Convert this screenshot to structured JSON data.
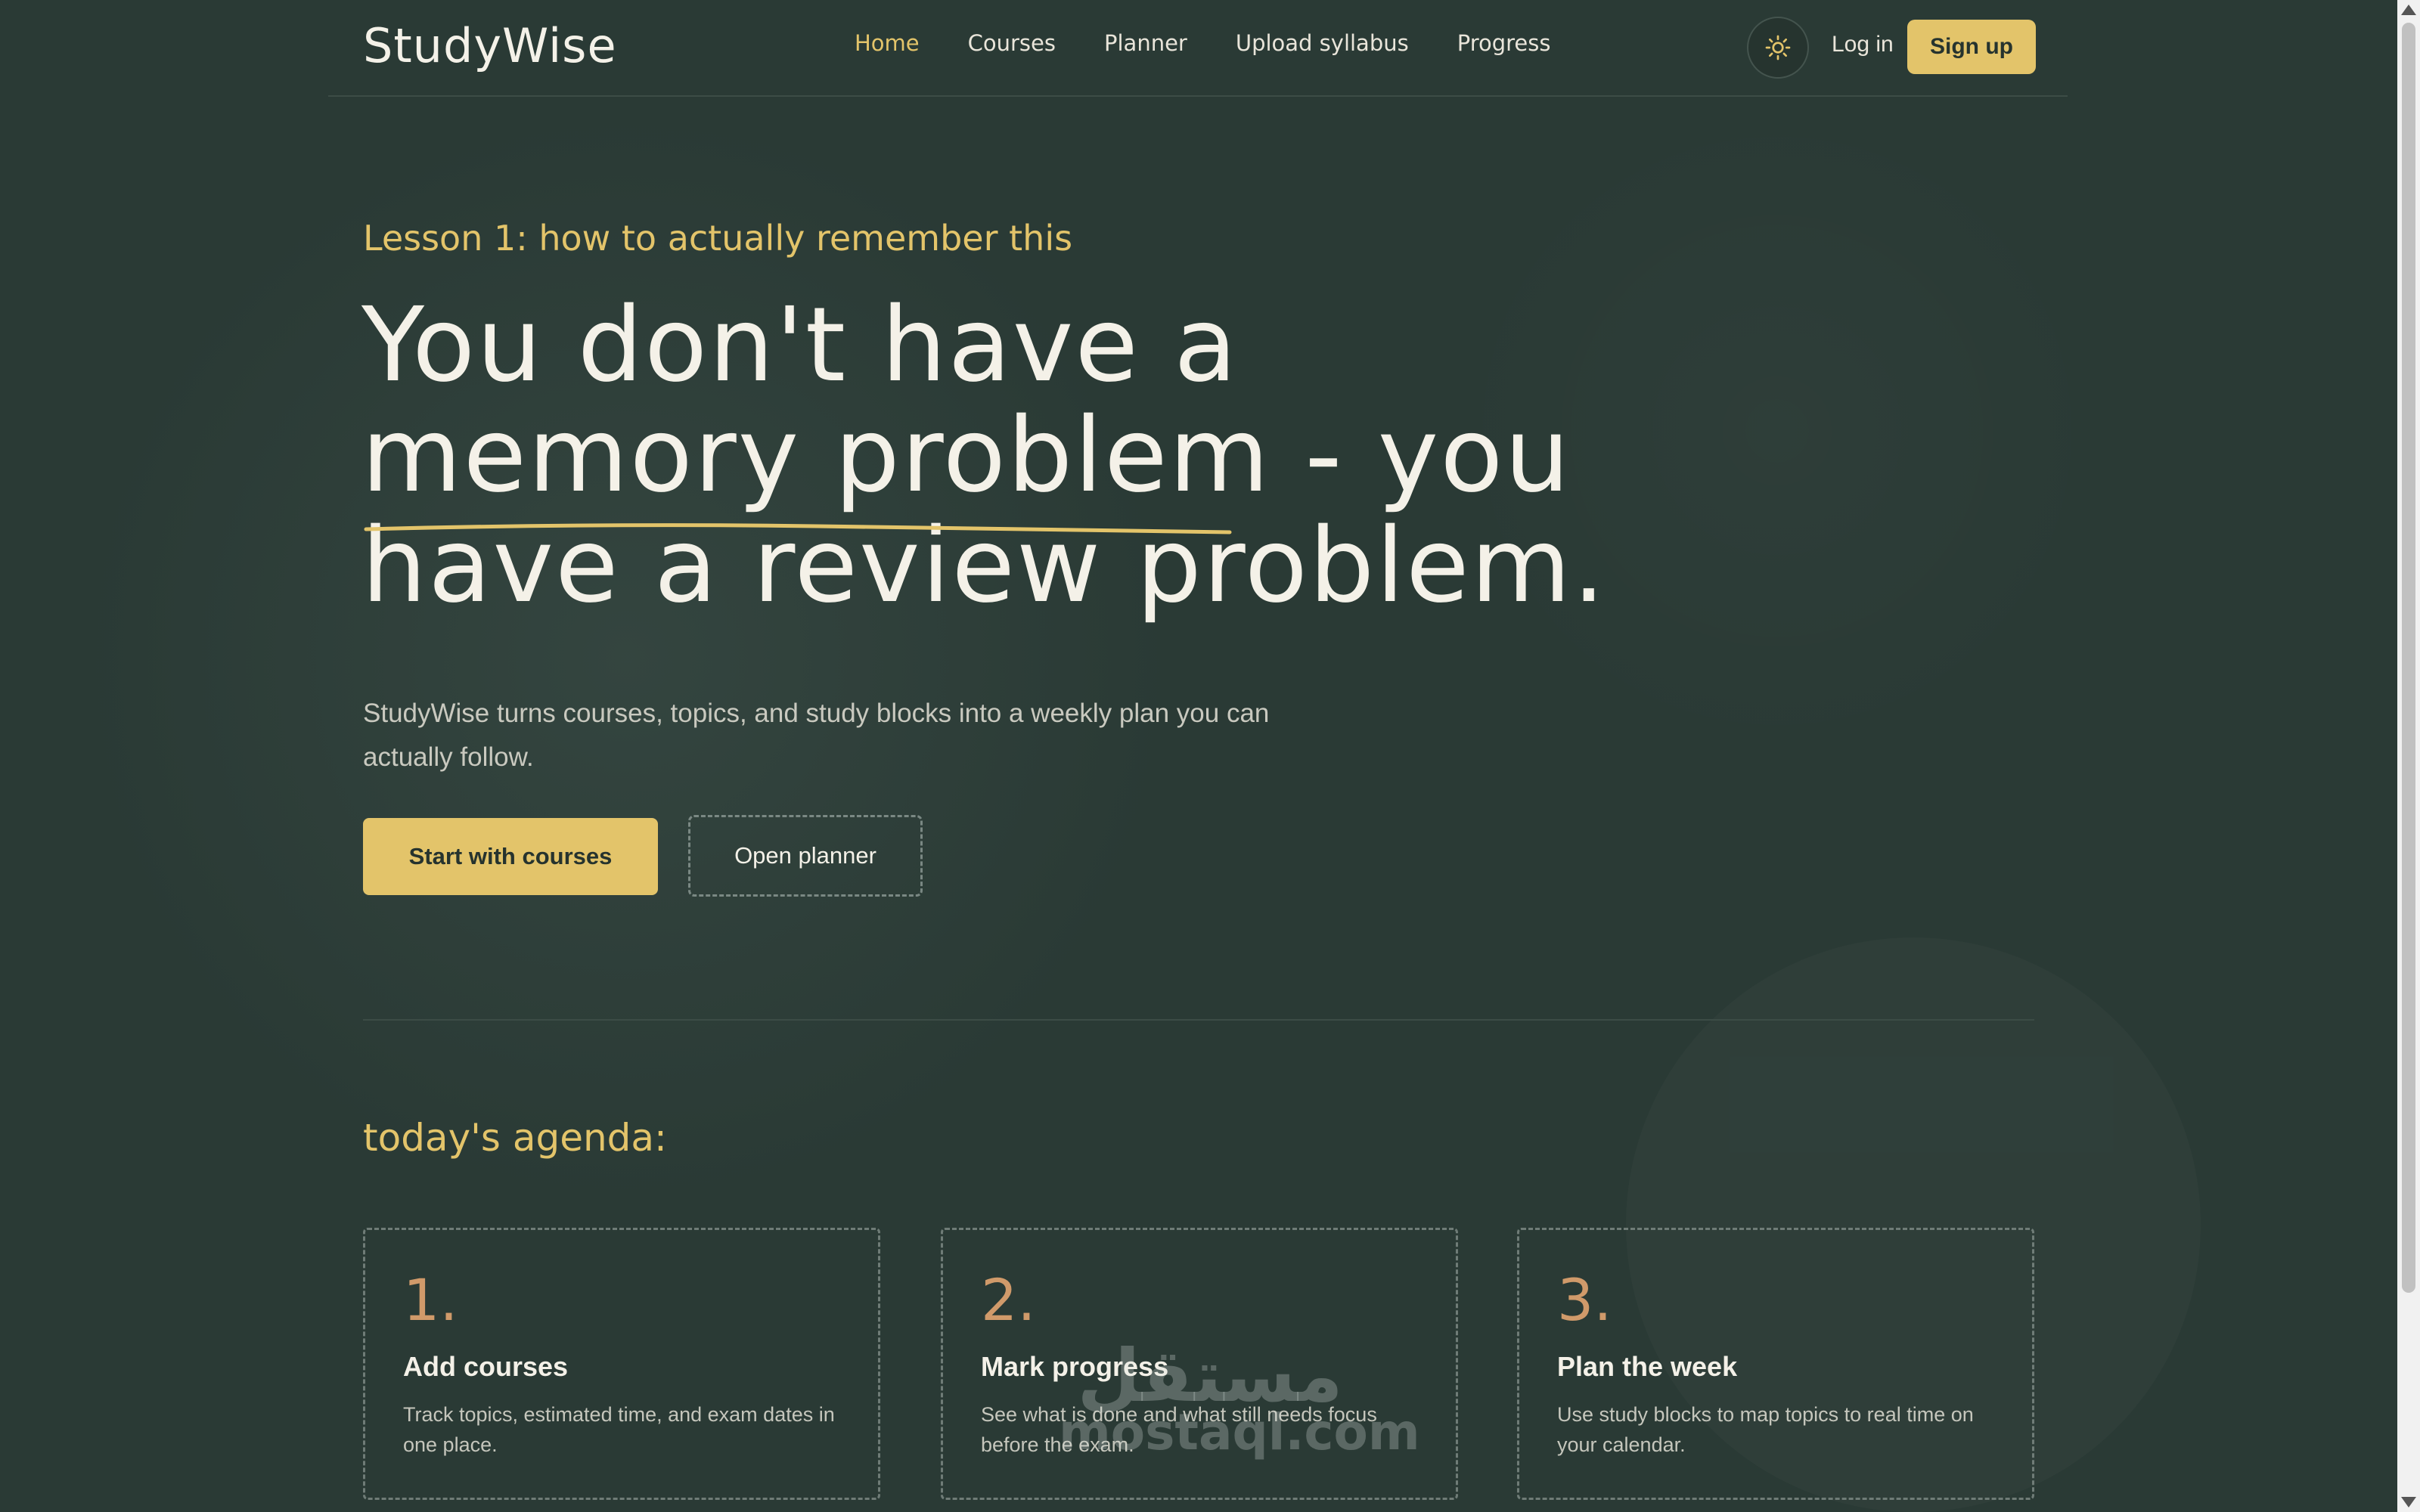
{
  "brand": "StudyWise",
  "nav": {
    "links": [
      "Home",
      "Courses",
      "Planner",
      "Upload syllabus",
      "Progress"
    ],
    "active": "Home",
    "theme_icon": "sun-icon",
    "login_label": "Log in",
    "signup_label": "Sign up"
  },
  "hero": {
    "eyebrow": "Lesson 1: how to actually remember this",
    "headline_lines": [
      "You don't have a",
      "memory problem - you",
      "have a review problem."
    ],
    "lede": "StudyWise turns courses, topics, and study blocks into a weekly plan you can actually follow.",
    "primary_cta": "Start with courses",
    "secondary_cta": "Open planner"
  },
  "agenda": {
    "title": "today's agenda:",
    "items": [
      {
        "number": "1.",
        "title": "Add courses",
        "description": "Track topics, estimated time, and exam dates in one place."
      },
      {
        "number": "2.",
        "title": "Mark progress",
        "description": "See what is done and what still needs focus before the exam."
      },
      {
        "number": "3.",
        "title": "Plan the week",
        "description": "Use study blocks to map topics to real time on your calendar."
      }
    ]
  },
  "watermark": {
    "arabic": "مستقل",
    "latin": "mostaql.com"
  },
  "colors": {
    "background": "#2a3a35",
    "accent": "#e3c46a",
    "number": "#d09a6a",
    "text": "#f4f1e8"
  }
}
